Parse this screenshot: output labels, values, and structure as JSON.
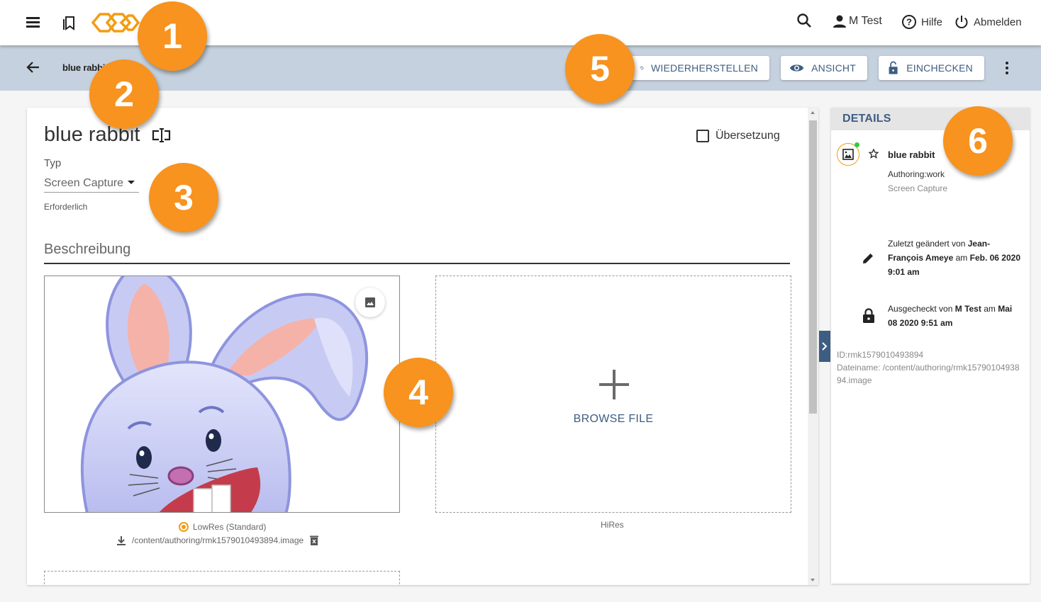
{
  "topbar": {
    "user_name": "M Test",
    "help_label": "Hilfe",
    "logout_label": "Abmelden"
  },
  "subbar": {
    "breadcrumb": "blue rabbit",
    "buttons": {
      "restore": "WIEDERHERSTELLEN",
      "view": "ANSICHT",
      "checkin": "EINCHECKEN"
    }
  },
  "editor": {
    "title": "blue rabbit",
    "translation_label": "Übersetzung",
    "type_label": "Typ",
    "type_value": "Screen Capture",
    "required_label": "Erforderlich",
    "section_title": "Beschreibung",
    "lowres_label": "LowRes (Standard)",
    "lowres_path": "/content/authoring/rmk1579010493894.image",
    "browse_label": "BROWSE FILE",
    "hires_label": "HiRes"
  },
  "details": {
    "header": "DETAILS",
    "name": "blue rabbit",
    "workflow": "Authoring:work",
    "type": "Screen Capture",
    "modified_prefix": "Zuletzt geändert von ",
    "modified_by": "Jean-François Ameye",
    "modified_mid": " am ",
    "modified_date": "Feb. 06 2020 9:01 am",
    "checkout_prefix": "Ausgecheckt von ",
    "checkout_by": "M Test",
    "checkout_mid": " am ",
    "checkout_date": "Mai 08 2020 9:51 am",
    "id": "ID:rmk1579010493894",
    "filename": "Dateiname: /content/authoring/rmk1579010493894.image"
  },
  "callouts": [
    "1",
    "2",
    "3",
    "4",
    "5",
    "6"
  ],
  "colors": {
    "accent_orange": "#f7931e",
    "toolbar_bg": "#c5d1de",
    "primary_blue": "#3e5d82"
  }
}
